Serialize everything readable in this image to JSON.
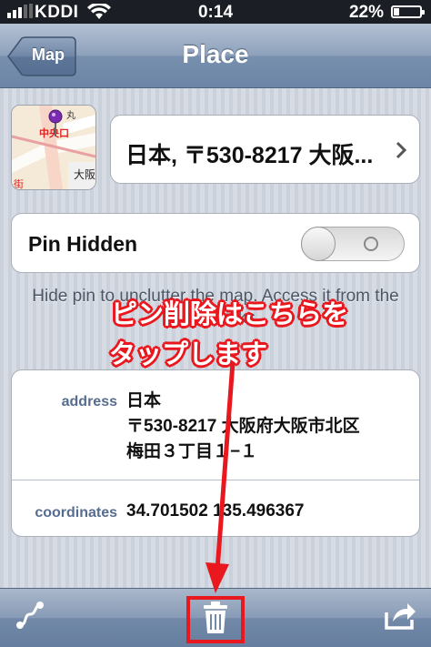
{
  "status_bar": {
    "carrier": "KDDI",
    "time": "0:14",
    "battery": "22%"
  },
  "nav": {
    "title": "Place",
    "back_label": "Map"
  },
  "thumbnail": {
    "labels": [
      "丸",
      "中央口",
      "大阪",
      "街"
    ]
  },
  "address_summary": "日本, 〒530-8217 大阪...",
  "pin_toggle": {
    "label": "Pin Hidden",
    "state": "off"
  },
  "pin_footer": "Hide pin to unclutter the map. Access it from the bookmarks.",
  "details": {
    "address_key": "address",
    "address_lines": [
      "日本",
      "〒530-8217 大阪府大阪市北区",
      "梅田３丁目１−１"
    ],
    "coordinates_key": "coordinates",
    "coordinates_value": "34.701502 135.496367"
  },
  "toolbar": {
    "left": "route-icon",
    "center": "trash-icon",
    "right": "share-icon"
  },
  "annotation": {
    "line1": "ピン削除はこちらを",
    "line2": "タップします",
    "color": "#e8181e"
  },
  "colors": {
    "nav_blue": "#7890ae",
    "key_blue": "#576d8f"
  }
}
